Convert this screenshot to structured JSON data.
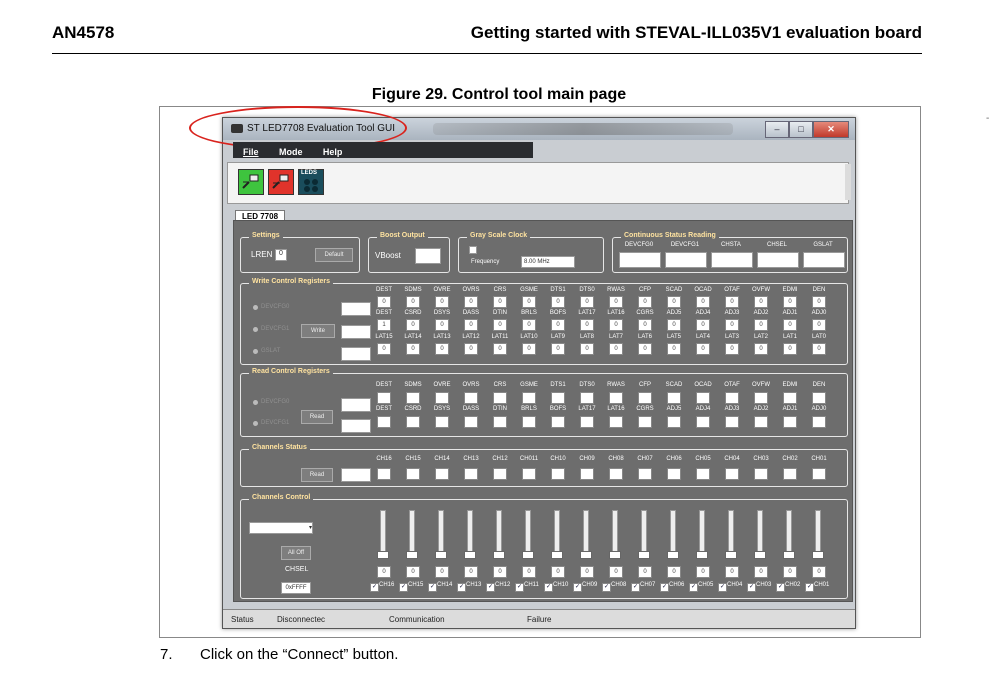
{
  "doc": {
    "id": "AN4578",
    "header_title": "Getting started with STEVAL-ILL035V1 evaluation board",
    "figure_caption": "Figure 29. Control tool main page",
    "step_number": "7.",
    "step_text": "Click on the “Connect” button."
  },
  "window": {
    "title": "ST LED7708 Evaluation Tool GUI",
    "menu": [
      "File",
      "Mode",
      "Help"
    ],
    "toolbar_badge": "LEDS",
    "tab": "LED 7708",
    "accent": "#d9231d"
  },
  "settings": {
    "label": "Settings",
    "lren_label": "LREN",
    "lren_value": "0",
    "default_btn": "Default"
  },
  "boost": {
    "label": "Boost Output",
    "vboost_label": "VBoost"
  },
  "grayscale": {
    "label": "Gray Scale Clock",
    "freq_label": "Frequency",
    "freq_value": "8.00 MHz"
  },
  "cont_status": {
    "label": "Continuous Status Reading",
    "headers": [
      "DEVCFG0",
      "DEVCFG1",
      "CHSTA",
      "CHSEL",
      "GSLAT"
    ]
  },
  "write_ctrl": {
    "label": "Write Control Registers",
    "write_btn": "Write",
    "radio_labels": [
      "DEVCFG0",
      "DEVCFG1",
      "GSLAT"
    ],
    "row1_headers": [
      "DEST",
      "SDMS",
      "OVRE",
      "OVRS",
      "CRS",
      "GSME",
      "DTS1",
      "DTS0",
      "RWAS",
      "CFP",
      "SCAD",
      "OCAD",
      "OTAF",
      "OVFW",
      "EDMI",
      "DEN"
    ],
    "row1_values": [
      "0",
      "0",
      "0",
      "0",
      "0",
      "0",
      "0",
      "0",
      "0",
      "0",
      "0",
      "0",
      "0",
      "0",
      "0",
      "0"
    ],
    "row2_headers": [
      "DEST",
      "CSRD",
      "DSYS",
      "DASS",
      "DTIN",
      "BRLS",
      "BOFS",
      "LAT17",
      "LAT16",
      "CGRS",
      "ADJ5",
      "ADJ4",
      "ADJ3",
      "ADJ2",
      "ADJ1",
      "ADJ0"
    ],
    "row2_values": [
      "1",
      "0",
      "0",
      "0",
      "0",
      "0",
      "0",
      "0",
      "0",
      "0",
      "0",
      "0",
      "0",
      "0",
      "0",
      "0"
    ],
    "row3_headers": [
      "LAT15",
      "LAT14",
      "LAT13",
      "LAT12",
      "LAT11",
      "LAT10",
      "LAT9",
      "LAT8",
      "LAT7",
      "LAT6",
      "LAT5",
      "LAT4",
      "LAT3",
      "LAT2",
      "LAT1",
      "LAT0"
    ],
    "row3_values": [
      "0",
      "0",
      "0",
      "0",
      "0",
      "0",
      "0",
      "0",
      "0",
      "0",
      "0",
      "0",
      "0",
      "0",
      "0",
      "0"
    ]
  },
  "read_ctrl": {
    "label": "Read Control Registers",
    "read_btn": "Read",
    "radio_labels": [
      "DEVCFG0",
      "DEVCFG1"
    ],
    "row1_headers": [
      "DEST",
      "SDMS",
      "OVRE",
      "OVRS",
      "CRS",
      "GSME",
      "DTS1",
      "DTS0",
      "RWAS",
      "CFP",
      "SCAD",
      "OCAD",
      "OTAF",
      "OVFW",
      "EDMI",
      "DEN"
    ],
    "row2_headers": [
      "DEST",
      "CSRD",
      "DSYS",
      "DASS",
      "DTIN",
      "BRLS",
      "BOFS",
      "LAT17",
      "LAT16",
      "CGRS",
      "ADJ5",
      "ADJ4",
      "ADJ3",
      "ADJ2",
      "ADJ1",
      "ADJ0"
    ]
  },
  "channels_status": {
    "label": "Channels Status",
    "read_btn": "Read",
    "headers": [
      "CH16",
      "CH15",
      "CH14",
      "CH13",
      "CH12",
      "CH011",
      "CH10",
      "CH09",
      "CH08",
      "CH07",
      "CH06",
      "CH05",
      "CH04",
      "CH03",
      "CH02",
      "CH01"
    ]
  },
  "channels_ctrl": {
    "label": "Channels Control",
    "alloff_btn": "All Off",
    "chsel_label": "CHSEL",
    "hex_value": "0xFFFF",
    "slider_values": [
      "0",
      "0",
      "0",
      "0",
      "0",
      "0",
      "0",
      "0",
      "0",
      "0",
      "0",
      "0",
      "0",
      "0",
      "0",
      "0"
    ],
    "check_labels": [
      "CH16",
      "CH15",
      "CH14",
      "CH13",
      "CH12",
      "CH11",
      "CH10",
      "CH09",
      "CH08",
      "CH07",
      "CH06",
      "CH05",
      "CH04",
      "CH03",
      "CH02",
      "CH01"
    ]
  },
  "statusbar": {
    "status_label": "Status",
    "status_value": "Disconnectec",
    "comm_label": "Communication",
    "comm_value": "Failure"
  }
}
